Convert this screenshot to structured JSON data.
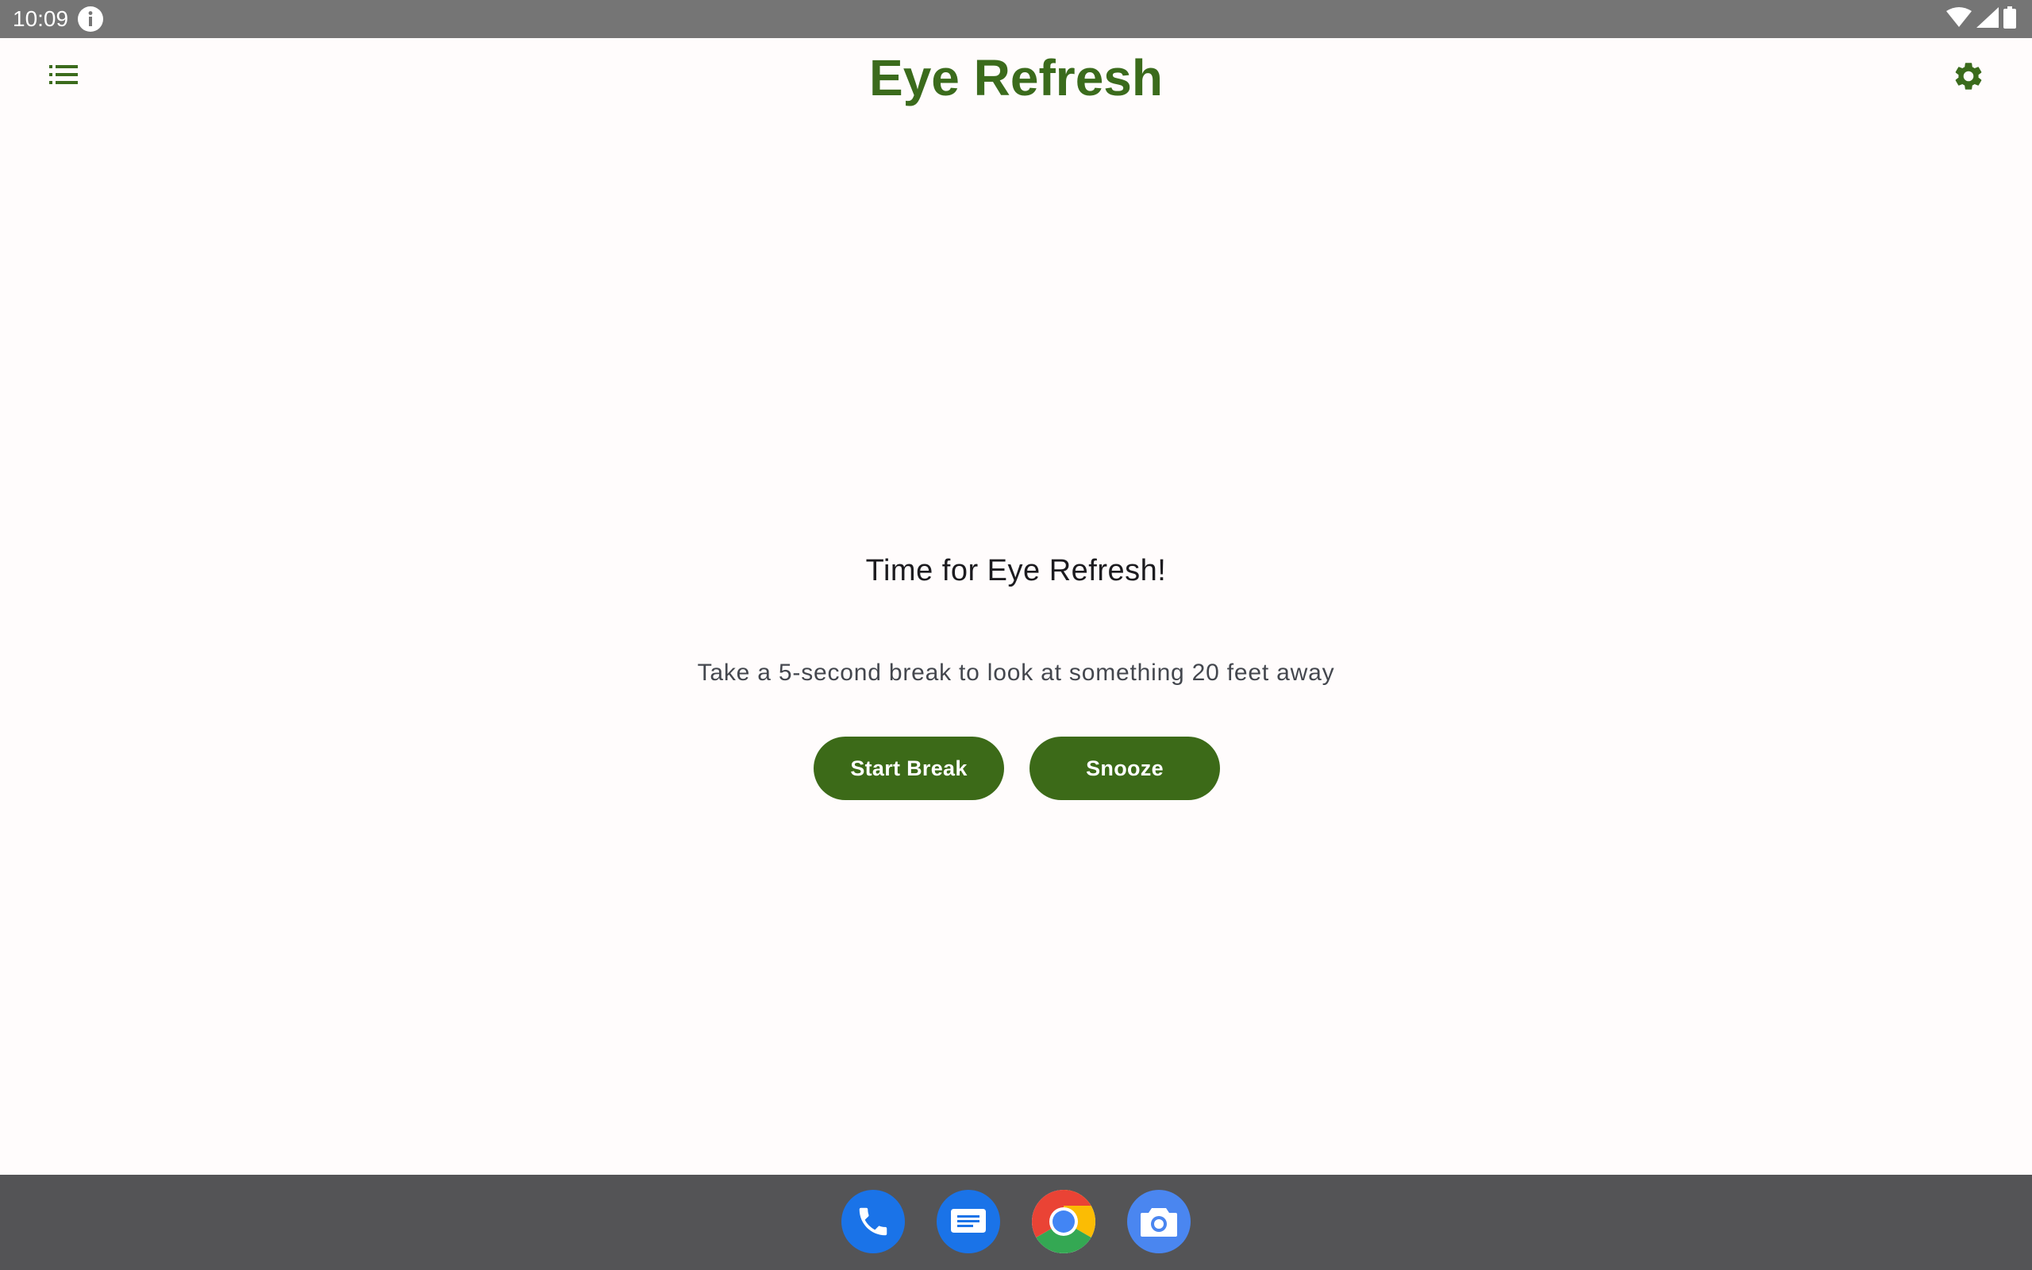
{
  "status_bar": {
    "time": "10:09",
    "icons": [
      "info-icon",
      "wifi-icon",
      "signal-icon",
      "battery-icon"
    ]
  },
  "app_bar": {
    "title": "Eye Refresh",
    "menu_icon": "list-icon",
    "settings_icon": "gear-icon"
  },
  "main": {
    "heading": "Time for Eye Refresh!",
    "message": "Take a 5-second break to look at something 20 feet away",
    "start_break_label": "Start Break",
    "snooze_label": "Snooze"
  },
  "dock": {
    "apps": [
      "phone-icon",
      "messages-icon",
      "chrome-icon",
      "camera-icon"
    ]
  },
  "colors": {
    "accent": "#3c6a18",
    "status_bar": "#757575",
    "nav_bar": "#545456",
    "background": "#fffcfc"
  }
}
